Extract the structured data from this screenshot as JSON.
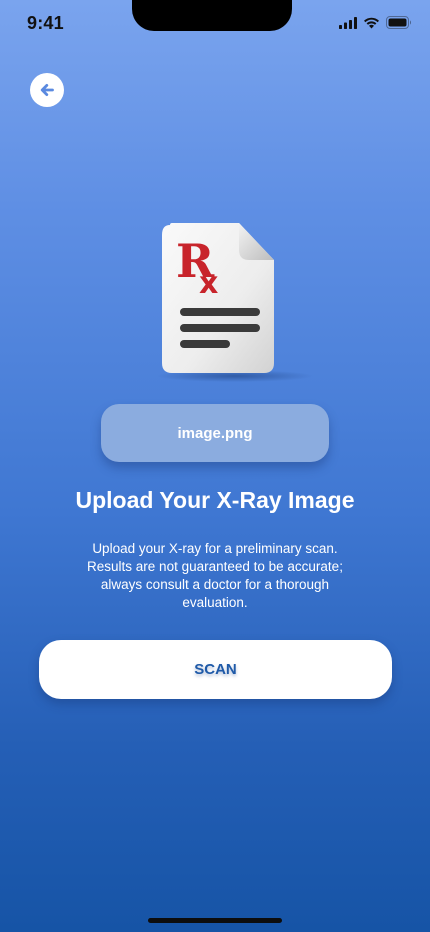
{
  "status_bar": {
    "time": "9:41"
  },
  "upload": {
    "file_name": "image.png",
    "title": "Upload Your X-Ray Image",
    "description": "Upload your X-ray for a preliminary scan. Results are not guaranteed to be accurate; always consult a doctor for a thorough evaluation."
  },
  "actions": {
    "scan_label": "SCAN"
  },
  "icons": {
    "back": "arrow-left-icon",
    "document": "prescription-document-icon",
    "signal": "signal-icon",
    "wifi": "wifi-icon",
    "battery": "battery-icon"
  },
  "colors": {
    "gradient_top": "#7aa4ee",
    "gradient_bottom": "#1654a6",
    "scan_text": "#1f5aa8",
    "rx_red": "#c8242b"
  }
}
